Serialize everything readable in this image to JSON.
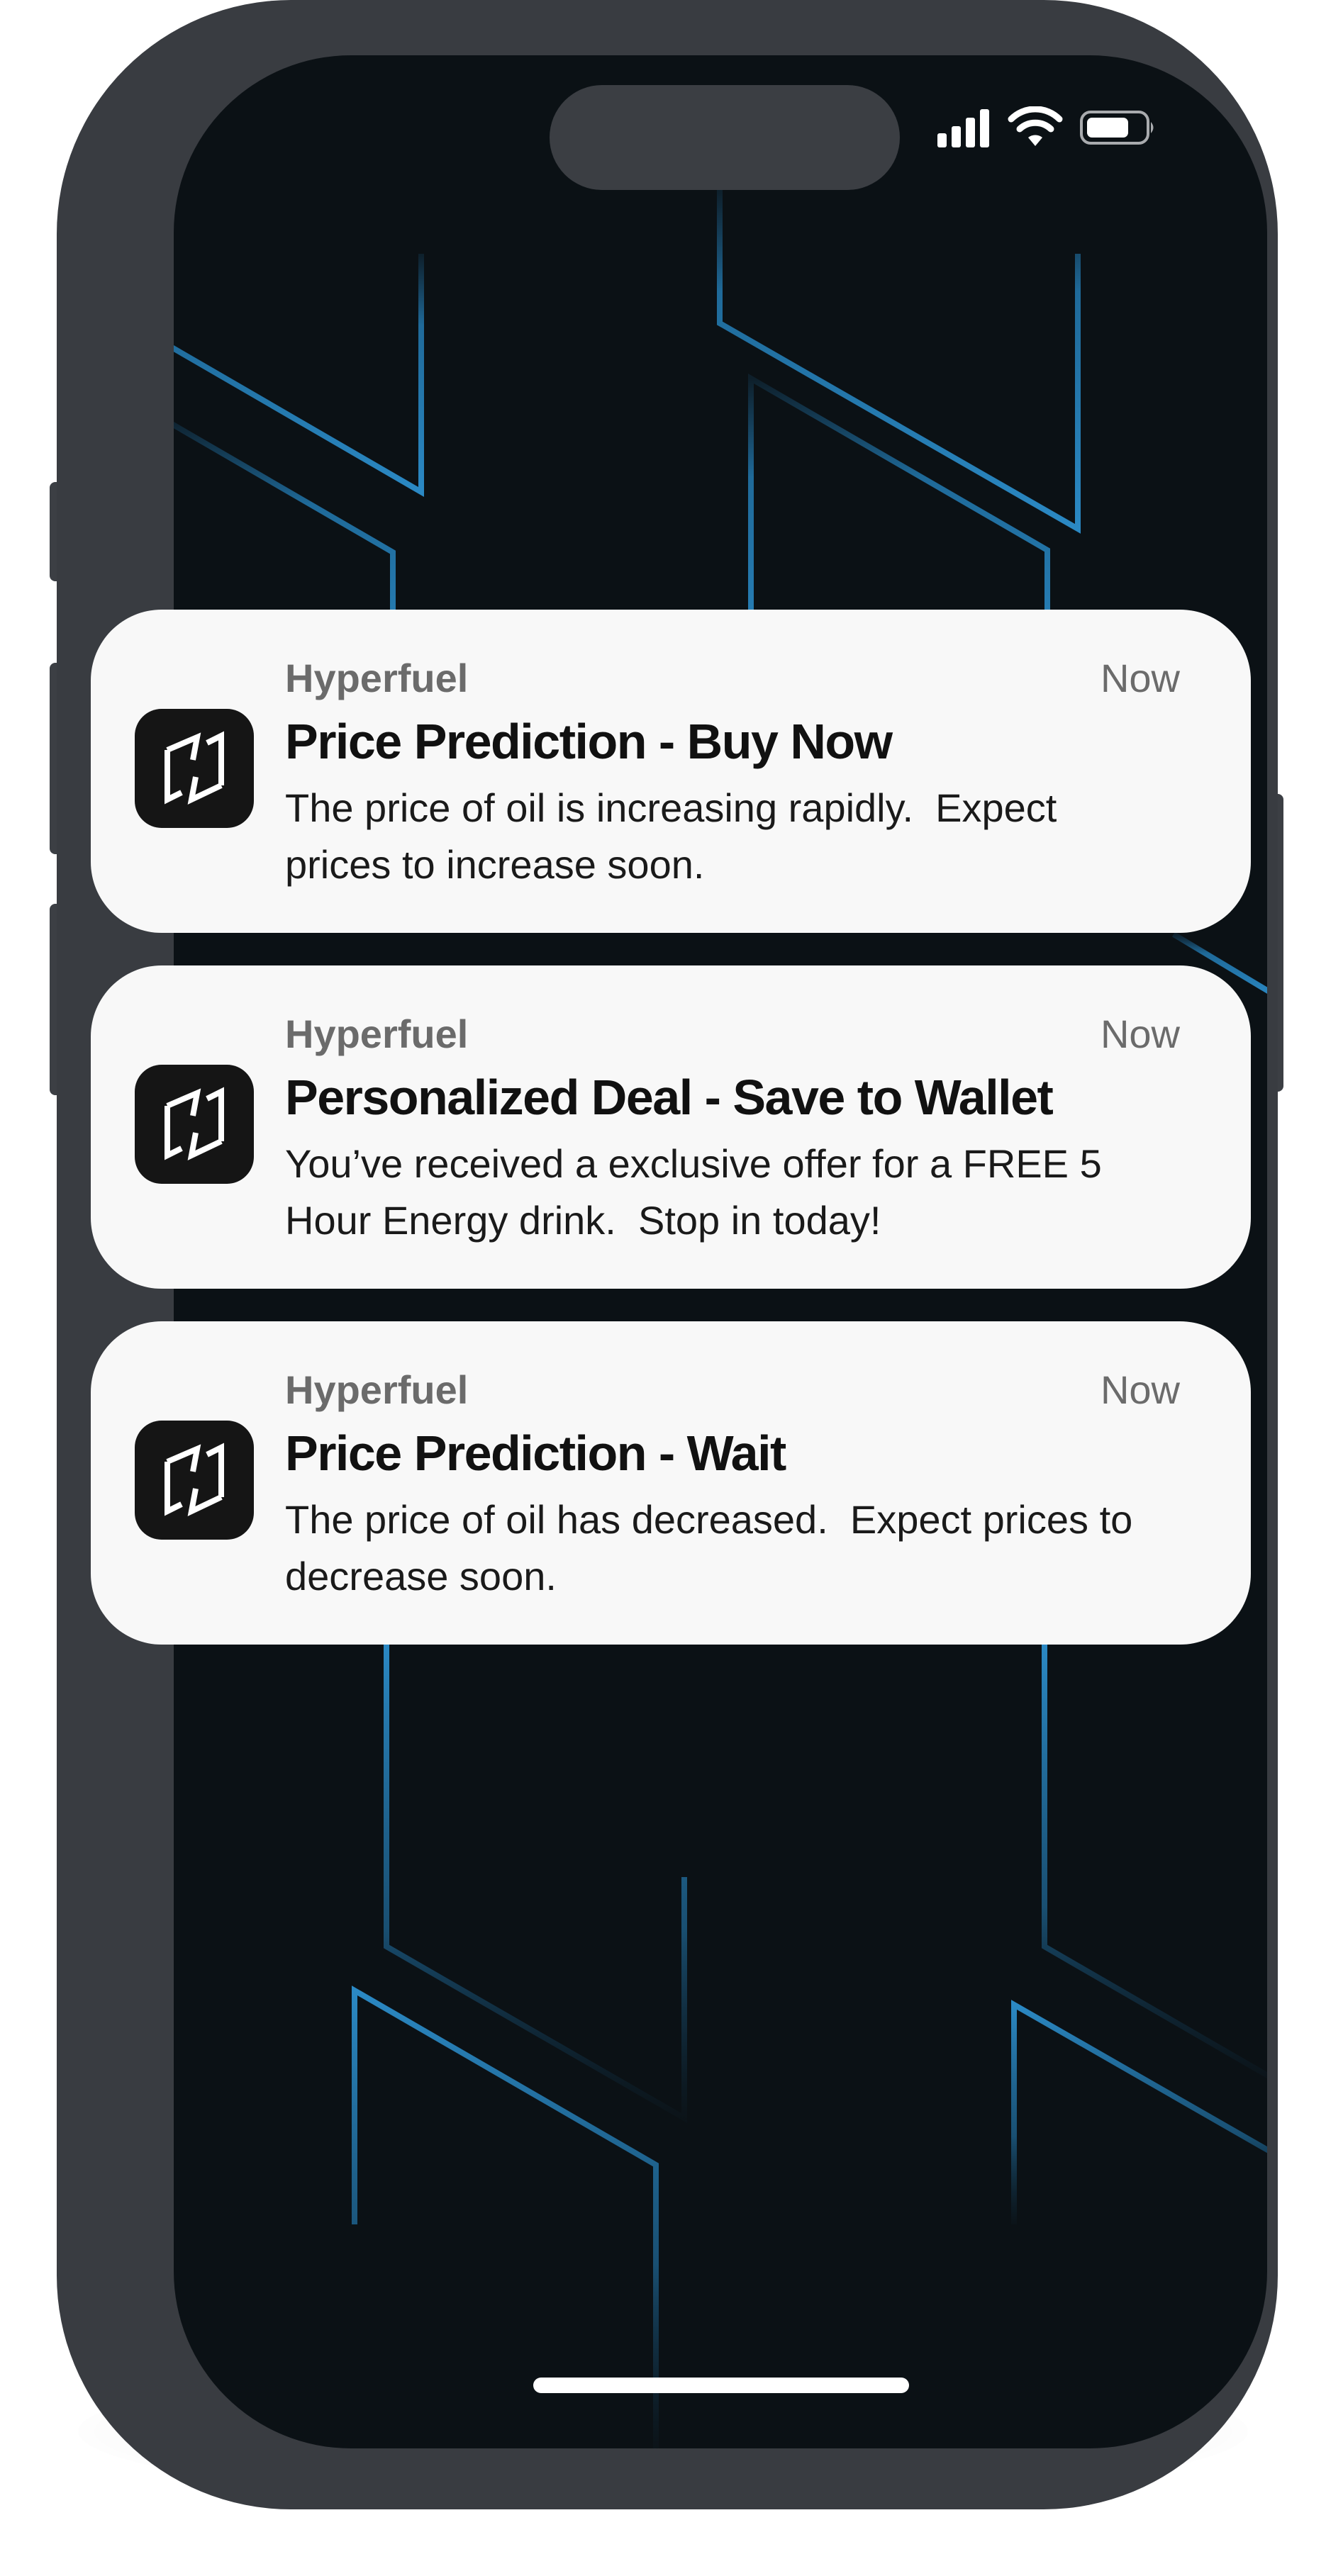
{
  "status_bar": {
    "signal_icon": "cellular-signal-icon",
    "wifi_icon": "wifi-icon",
    "battery_icon": "battery-icon"
  },
  "colors": {
    "wallpaper": "#0b1115",
    "line_accent": "#2b89c4",
    "frame": "#393c41",
    "card_background": "#f8f8f8",
    "app_icon_background": "#151515"
  },
  "notifications": [
    {
      "app_name": "Hyperfuel",
      "time": "Now",
      "title": "Price Prediction - Buy Now",
      "body": "The price of oil is increasing rapidly.  Expect\nprices to increase soon.",
      "icon": "hyperfuel-logo-icon"
    },
    {
      "app_name": "Hyperfuel",
      "time": "Now",
      "title": "Personalized Deal - Save to Wallet",
      "body": "You’ve received a exclusive offer for a FREE 5\nHour Energy drink.  Stop in today!",
      "icon": "hyperfuel-logo-icon"
    },
    {
      "app_name": "Hyperfuel",
      "time": "Now",
      "title": "Price Prediction - Wait",
      "body": "The price of oil has decreased.  Expect prices to\ndecrease soon.",
      "icon": "hyperfuel-logo-icon"
    }
  ]
}
